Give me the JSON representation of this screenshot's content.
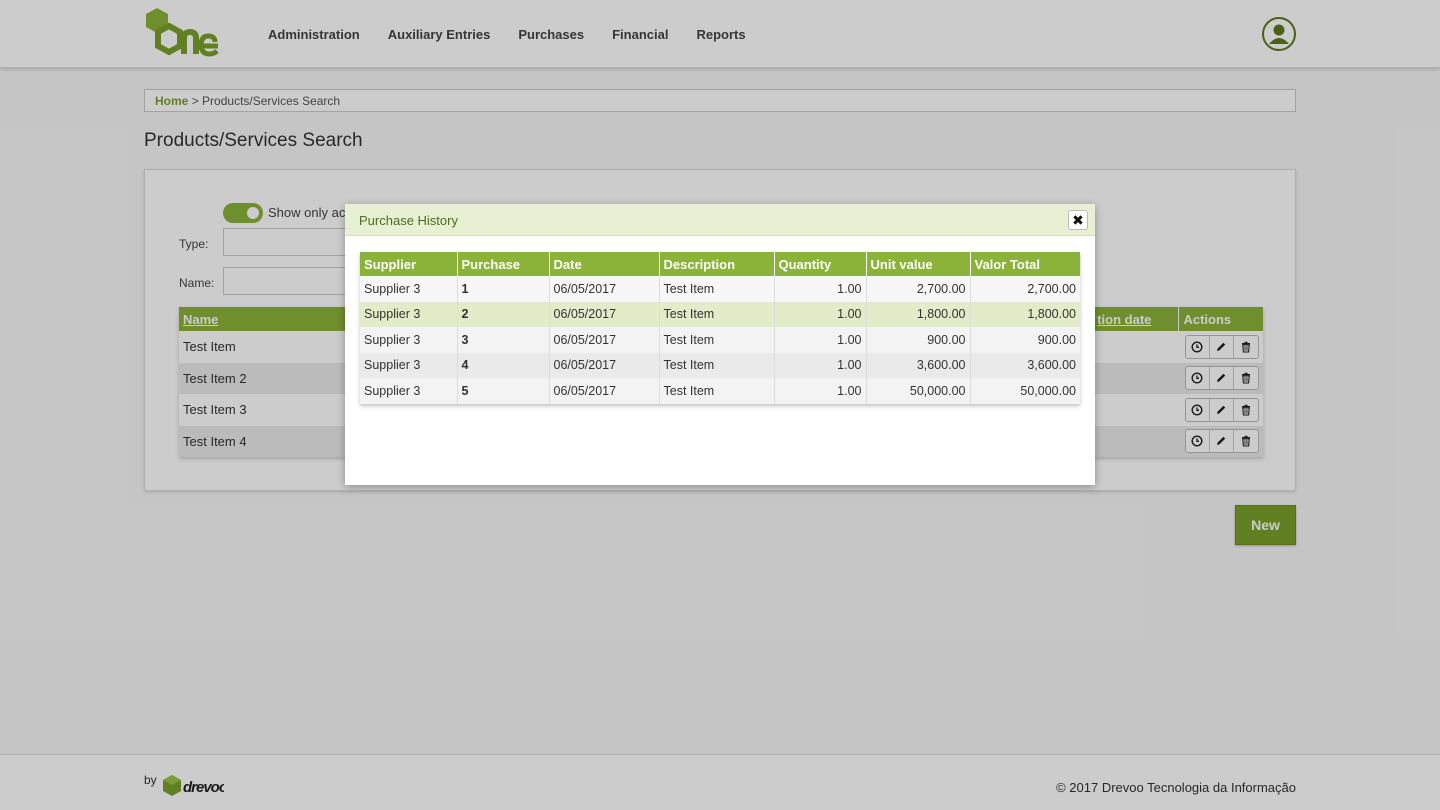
{
  "nav": {
    "items": [
      "Administration",
      "Auxiliary Entries",
      "Purchases",
      "Financial",
      "Reports"
    ]
  },
  "breadcrumb": {
    "home": "Home",
    "separator": ">",
    "current": "Products/Services Search"
  },
  "page": {
    "title": "Products/Services Search"
  },
  "filters": {
    "toggle_label": "Show only acti",
    "type_label": "Type:",
    "name_label": "Name:"
  },
  "results": {
    "headers": {
      "name": "Name",
      "date_partial": "tion date",
      "actions": "Actions"
    },
    "rows": [
      "Test Item",
      "Test Item 2",
      "Test Item 3",
      "Test Item 4"
    ]
  },
  "buttons": {
    "new": "New"
  },
  "footer": {
    "by": "by",
    "brand": "drevoo",
    "copyright": "© 2017 Drevoo Tecnologia da Informação"
  },
  "modal": {
    "title": "Purchase History",
    "close": "✖",
    "columns": [
      "Supplier",
      "Purchase",
      "Date",
      "Description",
      "Quantity",
      "Unit value",
      "Valor Total"
    ],
    "rows": [
      [
        "Supplier 3",
        "1",
        "06/05/2017",
        "Test Item",
        "1.00",
        "2,700.00",
        "2,700.00"
      ],
      [
        "Supplier 3",
        "2",
        "06/05/2017",
        "Test Item",
        "1.00",
        "1,800.00",
        "1,800.00"
      ],
      [
        "Supplier 3",
        "3",
        "06/05/2017",
        "Test Item",
        "1.00",
        "900.00",
        "900.00"
      ],
      [
        "Supplier 3",
        "4",
        "06/05/2017",
        "Test Item",
        "1.00",
        "3,600.00",
        "3,600.00"
      ],
      [
        "Supplier 3",
        "5",
        "06/05/2017",
        "Test Item",
        "1.00",
        "50,000.00",
        "50,000.00"
      ]
    ]
  },
  "colors": {
    "accent": "#8bb33a",
    "accent_dark": "#7aa12a",
    "modal_header": "#e7f0d3"
  },
  "icons": [
    "logo-one",
    "user-icon",
    "history-icon",
    "edit-icon",
    "trash-icon",
    "close-icon",
    "drevoo-logo"
  ]
}
